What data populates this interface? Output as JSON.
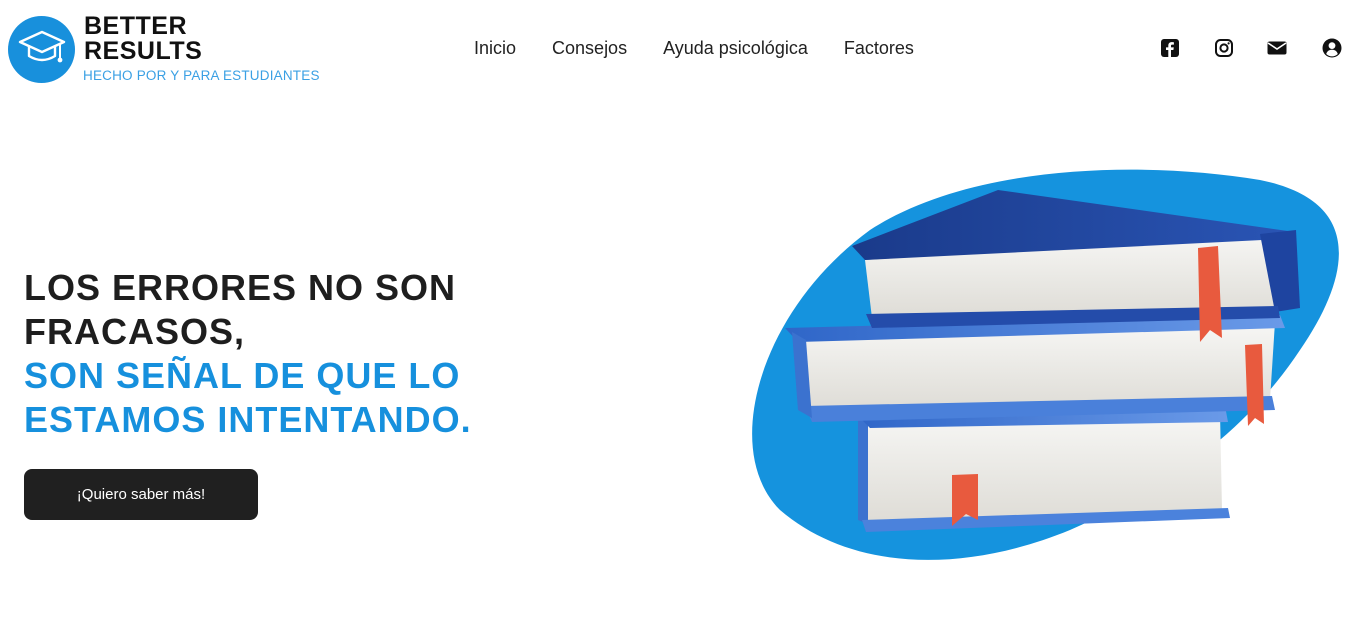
{
  "brand": {
    "title_line1": "BETTER",
    "title_line2": "RESULTS",
    "tagline": "HECHO POR Y PARA ESTUDIANTES",
    "logo_icon": "graduation-cap-icon",
    "color": "#1890dc"
  },
  "nav": {
    "items": [
      {
        "label": "Inicio"
      },
      {
        "label": "Consejos"
      },
      {
        "label": "Ayuda psicológica"
      },
      {
        "label": "Factores"
      }
    ]
  },
  "socials": [
    {
      "icon": "facebook-icon"
    },
    {
      "icon": "instagram-icon"
    },
    {
      "icon": "mail-icon"
    },
    {
      "icon": "user-account-icon"
    }
  ],
  "hero": {
    "line1": "LOS ERRORES NO SON",
    "line2": "FRACASOS,",
    "line3": "SON SEÑAL DE QUE LO",
    "line4": "ESTAMOS INTENTANDO.",
    "cta_label": "¡Quiero saber más!",
    "accent_color": "#1690dd",
    "dark_color": "#1e1e1e"
  },
  "illustration": {
    "subject": "stack-of-books-illustration",
    "blob_color": "#1593de"
  }
}
